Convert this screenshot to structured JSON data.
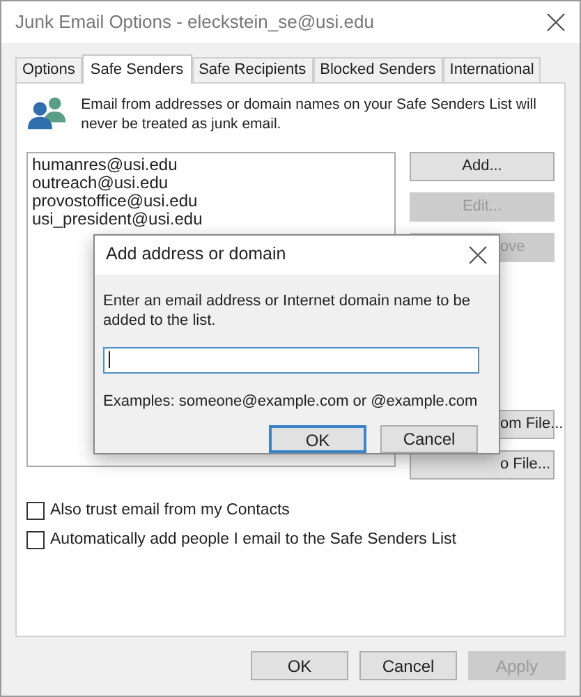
{
  "window": {
    "title": "Junk Email Options - eleckstein_se@usi.edu"
  },
  "tabs": [
    {
      "label": "Options",
      "selected": false
    },
    {
      "label": "Safe Senders",
      "selected": true
    },
    {
      "label": "Safe Recipients",
      "selected": false
    },
    {
      "label": "Blocked Senders",
      "selected": false
    },
    {
      "label": "International",
      "selected": false
    }
  ],
  "description": "Email from addresses or domain names on your Safe Senders List will never be treated as junk email.",
  "senders": [
    "humanres@usi.edu",
    "outreach@usi.edu",
    "provostoffice@usi.edu",
    "usi_president@usi.edu"
  ],
  "side_buttons": [
    {
      "label": "Add...",
      "disabled": false,
      "kind": "full"
    },
    {
      "label": "Edit...",
      "disabled": true,
      "kind": "full"
    },
    {
      "label": "ove",
      "disabled": true,
      "kind": "partial"
    },
    {
      "label": "om File...",
      "disabled": false,
      "kind": "partial"
    },
    {
      "label": "o File...",
      "disabled": false,
      "kind": "partial"
    }
  ],
  "checkboxes": [
    {
      "label": "Also trust email from my Contacts",
      "checked": false
    },
    {
      "label": "Automatically add people I email to the Safe Senders List",
      "checked": false
    }
  ],
  "dialog": {
    "title": "Add address or domain",
    "prompt": "Enter an email address or Internet domain name to be added to the list.",
    "hint": "Examples: someone@example.com or @example.com",
    "buttons": [
      {
        "label": "OK",
        "default": true
      },
      {
        "label": "Cancel",
        "default": false
      }
    ]
  },
  "footer_buttons": [
    {
      "label": "OK",
      "disabled": false
    },
    {
      "label": "Cancel",
      "disabled": false
    },
    {
      "label": "Apply",
      "disabled": true
    }
  ]
}
